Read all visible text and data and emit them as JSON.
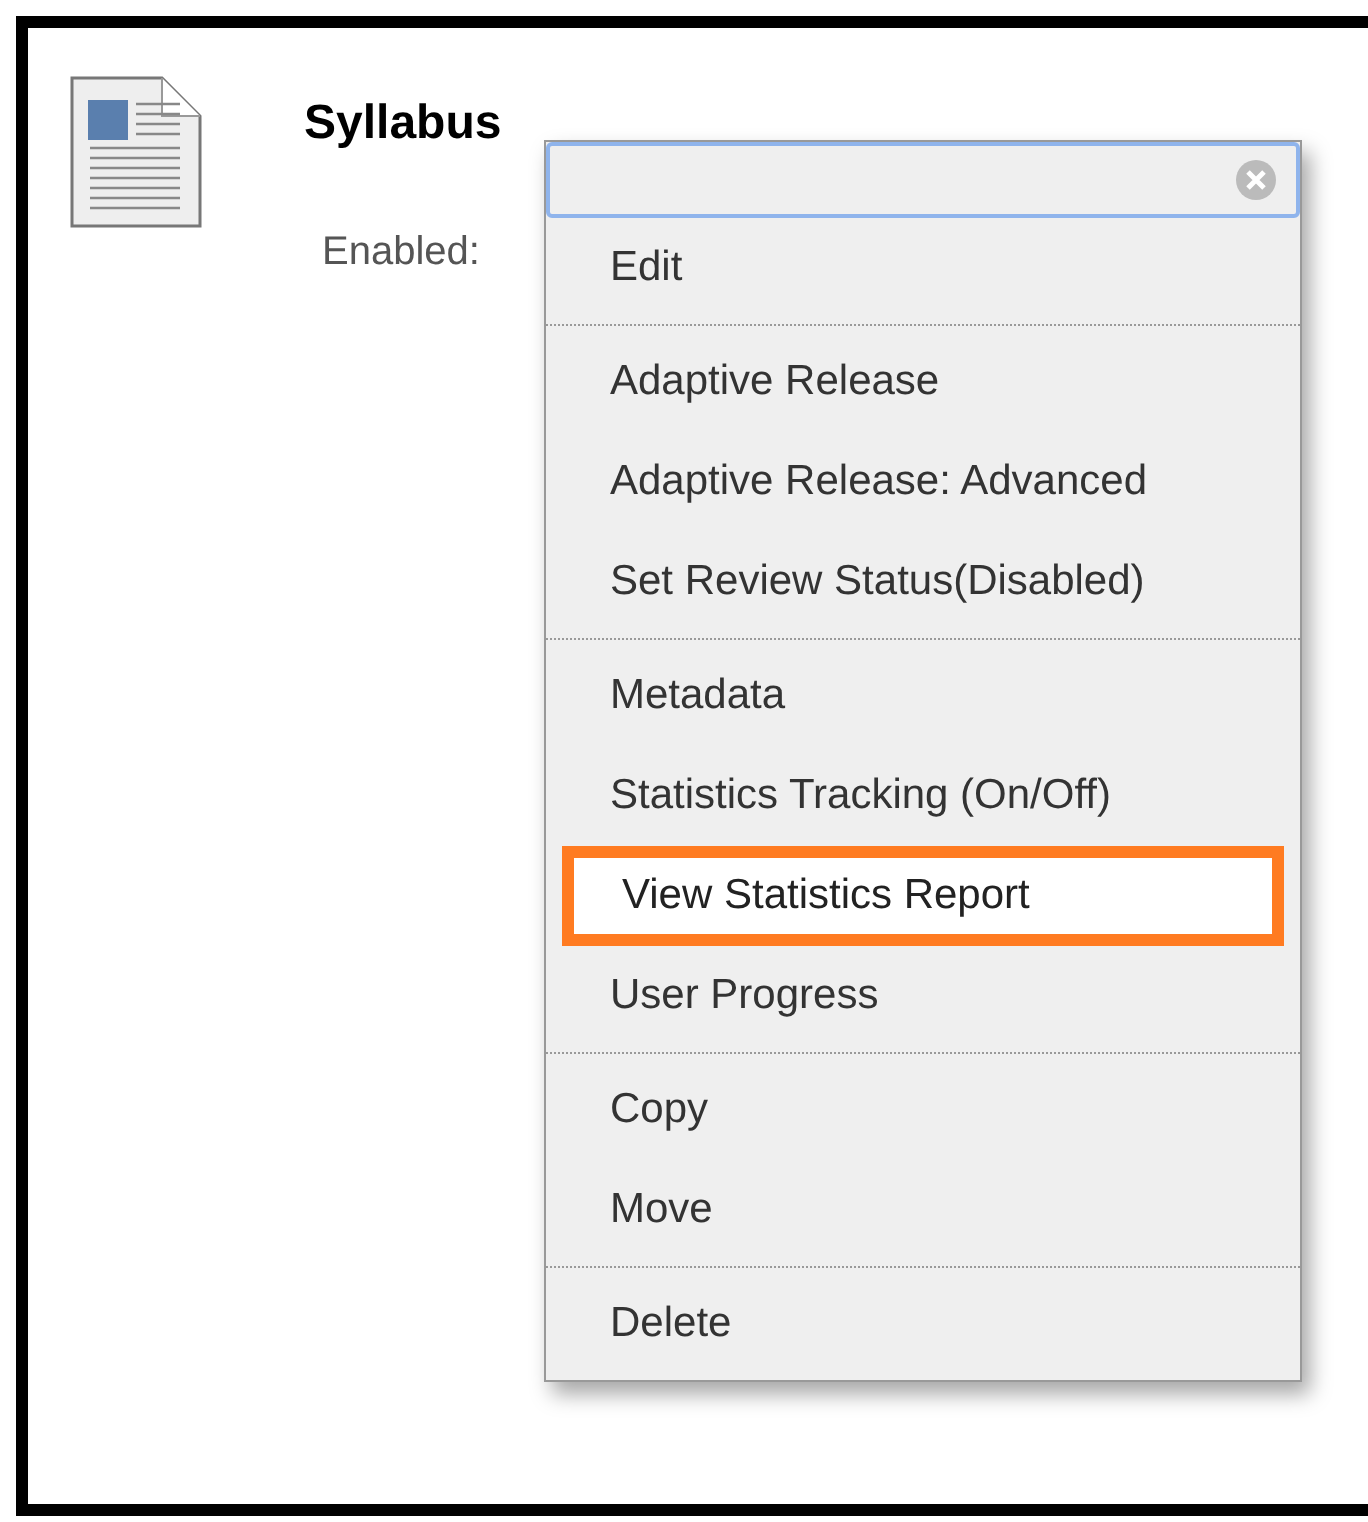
{
  "item": {
    "title": "Syllabus",
    "status_label": "Enabled:"
  },
  "menu": {
    "groups": [
      {
        "items": [
          {
            "label": "Edit",
            "selected": false
          }
        ]
      },
      {
        "items": [
          {
            "label": "Adaptive Release",
            "selected": false
          },
          {
            "label": "Adaptive Release: Advanced",
            "selected": false
          },
          {
            "label": "Set Review Status(Disabled)",
            "selected": false
          }
        ]
      },
      {
        "items": [
          {
            "label": "Metadata",
            "selected": false
          },
          {
            "label": "Statistics Tracking (On/Off)",
            "selected": false
          },
          {
            "label": "View Statistics Report",
            "selected": true
          },
          {
            "label": "User Progress",
            "selected": false
          }
        ]
      },
      {
        "items": [
          {
            "label": "Copy",
            "selected": false
          },
          {
            "label": "Move",
            "selected": false
          }
        ]
      },
      {
        "items": [
          {
            "label": "Delete",
            "selected": false
          }
        ]
      }
    ]
  }
}
